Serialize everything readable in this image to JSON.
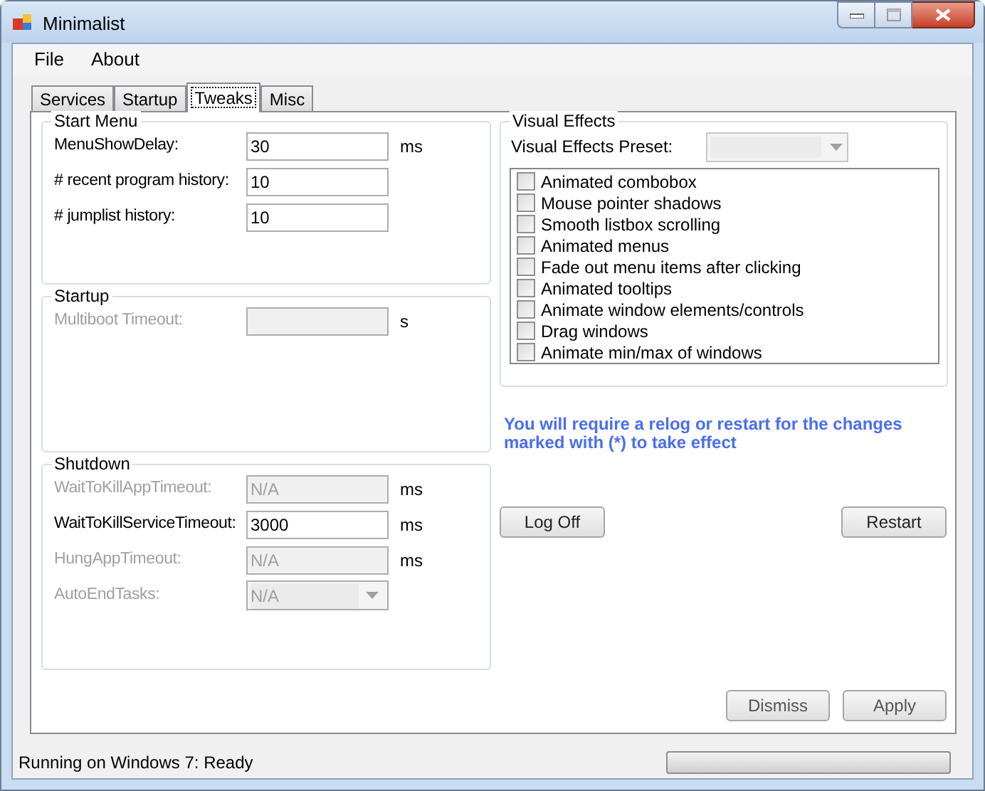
{
  "window": {
    "title": "Minimalist"
  },
  "menu": [
    "File",
    "About"
  ],
  "tabs": [
    {
      "label": "Services",
      "selected": false
    },
    {
      "label": "Startup",
      "selected": false
    },
    {
      "label": "Tweaks",
      "selected": true
    },
    {
      "label": "Misc",
      "selected": false
    }
  ],
  "groups": [
    {
      "title": "Start Menu",
      "rows": [
        {
          "label": "MenuShowDelay:",
          "kind": "text",
          "value": "30",
          "unit": "ms",
          "disabled": false
        },
        {
          "label": "# recent program history:",
          "kind": "text",
          "value": "10",
          "disabled": false
        },
        {
          "label": "# jumplist history:",
          "kind": "text",
          "value": "10",
          "disabled": false
        }
      ]
    },
    {
      "title": "Startup",
      "rows": [
        {
          "label": "Multiboot Timeout:",
          "kind": "text",
          "value": "",
          "unit": "s",
          "disabled": true
        }
      ]
    },
    {
      "title": "Shutdown",
      "rows": [
        {
          "label": "WaitToKillAppTimeout:",
          "kind": "text",
          "value": "N/A",
          "unit": "ms",
          "disabled": true
        },
        {
          "label": "WaitToKillServiceTimeout:",
          "kind": "text",
          "value": "3000",
          "unit": "ms",
          "disabled": false
        },
        {
          "label": "HungAppTimeout:",
          "kind": "text",
          "value": "N/A",
          "unit": "ms",
          "disabled": true
        },
        {
          "label": "AutoEndTasks:",
          "kind": "combo",
          "value": "N/A",
          "disabled": true
        }
      ]
    }
  ],
  "visual_effects": {
    "title": "Visual Effects",
    "preset_label": "Visual Effects Preset:",
    "preset_disabled": true,
    "items": [
      {
        "label": "Animated combobox",
        "checked": false
      },
      {
        "label": "Mouse pointer shadows",
        "checked": false
      },
      {
        "label": "Smooth listbox scrolling",
        "checked": false
      },
      {
        "label": "Animated menus",
        "checked": false
      },
      {
        "label": "Fade out menu items after clicking",
        "checked": false
      },
      {
        "label": "Animated tooltips",
        "checked": false
      },
      {
        "label": "Animate window elements/controls",
        "checked": false
      },
      {
        "label": "Drag windows",
        "checked": false
      },
      {
        "label": "Animate min/max of windows",
        "checked": false
      }
    ]
  },
  "notice": "You will require a relog or restart for the changes marked with (*) to take effect",
  "action_buttons": [
    "Log Off",
    "Restart"
  ],
  "dialog_buttons": [
    "Dismiss",
    "Apply"
  ],
  "status_bar": {
    "text": "Running on Windows 7: Ready",
    "progress": {
      "level": 0
    }
  }
}
